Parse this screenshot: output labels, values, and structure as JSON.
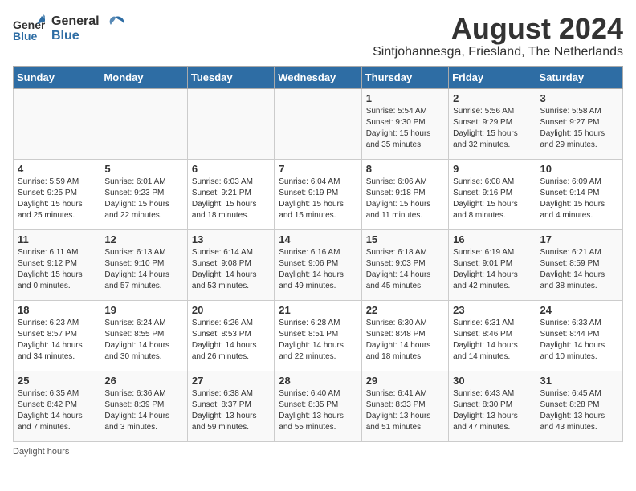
{
  "header": {
    "logo_general": "General",
    "logo_blue": "Blue",
    "month_year": "August 2024",
    "location": "Sintjohannesga, Friesland, The Netherlands"
  },
  "days_of_week": [
    "Sunday",
    "Monday",
    "Tuesday",
    "Wednesday",
    "Thursday",
    "Friday",
    "Saturday"
  ],
  "footer": "Daylight hours",
  "weeks": [
    [
      {
        "day": "",
        "content": ""
      },
      {
        "day": "",
        "content": ""
      },
      {
        "day": "",
        "content": ""
      },
      {
        "day": "",
        "content": ""
      },
      {
        "day": "1",
        "content": "Sunrise: 5:54 AM\nSunset: 9:30 PM\nDaylight: 15 hours\nand 35 minutes."
      },
      {
        "day": "2",
        "content": "Sunrise: 5:56 AM\nSunset: 9:29 PM\nDaylight: 15 hours\nand 32 minutes."
      },
      {
        "day": "3",
        "content": "Sunrise: 5:58 AM\nSunset: 9:27 PM\nDaylight: 15 hours\nand 29 minutes."
      }
    ],
    [
      {
        "day": "4",
        "content": "Sunrise: 5:59 AM\nSunset: 9:25 PM\nDaylight: 15 hours\nand 25 minutes."
      },
      {
        "day": "5",
        "content": "Sunrise: 6:01 AM\nSunset: 9:23 PM\nDaylight: 15 hours\nand 22 minutes."
      },
      {
        "day": "6",
        "content": "Sunrise: 6:03 AM\nSunset: 9:21 PM\nDaylight: 15 hours\nand 18 minutes."
      },
      {
        "day": "7",
        "content": "Sunrise: 6:04 AM\nSunset: 9:19 PM\nDaylight: 15 hours\nand 15 minutes."
      },
      {
        "day": "8",
        "content": "Sunrise: 6:06 AM\nSunset: 9:18 PM\nDaylight: 15 hours\nand 11 minutes."
      },
      {
        "day": "9",
        "content": "Sunrise: 6:08 AM\nSunset: 9:16 PM\nDaylight: 15 hours\nand 8 minutes."
      },
      {
        "day": "10",
        "content": "Sunrise: 6:09 AM\nSunset: 9:14 PM\nDaylight: 15 hours\nand 4 minutes."
      }
    ],
    [
      {
        "day": "11",
        "content": "Sunrise: 6:11 AM\nSunset: 9:12 PM\nDaylight: 15 hours\nand 0 minutes."
      },
      {
        "day": "12",
        "content": "Sunrise: 6:13 AM\nSunset: 9:10 PM\nDaylight: 14 hours\nand 57 minutes."
      },
      {
        "day": "13",
        "content": "Sunrise: 6:14 AM\nSunset: 9:08 PM\nDaylight: 14 hours\nand 53 minutes."
      },
      {
        "day": "14",
        "content": "Sunrise: 6:16 AM\nSunset: 9:06 PM\nDaylight: 14 hours\nand 49 minutes."
      },
      {
        "day": "15",
        "content": "Sunrise: 6:18 AM\nSunset: 9:03 PM\nDaylight: 14 hours\nand 45 minutes."
      },
      {
        "day": "16",
        "content": "Sunrise: 6:19 AM\nSunset: 9:01 PM\nDaylight: 14 hours\nand 42 minutes."
      },
      {
        "day": "17",
        "content": "Sunrise: 6:21 AM\nSunset: 8:59 PM\nDaylight: 14 hours\nand 38 minutes."
      }
    ],
    [
      {
        "day": "18",
        "content": "Sunrise: 6:23 AM\nSunset: 8:57 PM\nDaylight: 14 hours\nand 34 minutes."
      },
      {
        "day": "19",
        "content": "Sunrise: 6:24 AM\nSunset: 8:55 PM\nDaylight: 14 hours\nand 30 minutes."
      },
      {
        "day": "20",
        "content": "Sunrise: 6:26 AM\nSunset: 8:53 PM\nDaylight: 14 hours\nand 26 minutes."
      },
      {
        "day": "21",
        "content": "Sunrise: 6:28 AM\nSunset: 8:51 PM\nDaylight: 14 hours\nand 22 minutes."
      },
      {
        "day": "22",
        "content": "Sunrise: 6:30 AM\nSunset: 8:48 PM\nDaylight: 14 hours\nand 18 minutes."
      },
      {
        "day": "23",
        "content": "Sunrise: 6:31 AM\nSunset: 8:46 PM\nDaylight: 14 hours\nand 14 minutes."
      },
      {
        "day": "24",
        "content": "Sunrise: 6:33 AM\nSunset: 8:44 PM\nDaylight: 14 hours\nand 10 minutes."
      }
    ],
    [
      {
        "day": "25",
        "content": "Sunrise: 6:35 AM\nSunset: 8:42 PM\nDaylight: 14 hours\nand 7 minutes."
      },
      {
        "day": "26",
        "content": "Sunrise: 6:36 AM\nSunset: 8:39 PM\nDaylight: 14 hours\nand 3 minutes."
      },
      {
        "day": "27",
        "content": "Sunrise: 6:38 AM\nSunset: 8:37 PM\nDaylight: 13 hours\nand 59 minutes."
      },
      {
        "day": "28",
        "content": "Sunrise: 6:40 AM\nSunset: 8:35 PM\nDaylight: 13 hours\nand 55 minutes."
      },
      {
        "day": "29",
        "content": "Sunrise: 6:41 AM\nSunset: 8:33 PM\nDaylight: 13 hours\nand 51 minutes."
      },
      {
        "day": "30",
        "content": "Sunrise: 6:43 AM\nSunset: 8:30 PM\nDaylight: 13 hours\nand 47 minutes."
      },
      {
        "day": "31",
        "content": "Sunrise: 6:45 AM\nSunset: 8:28 PM\nDaylight: 13 hours\nand 43 minutes."
      }
    ]
  ]
}
